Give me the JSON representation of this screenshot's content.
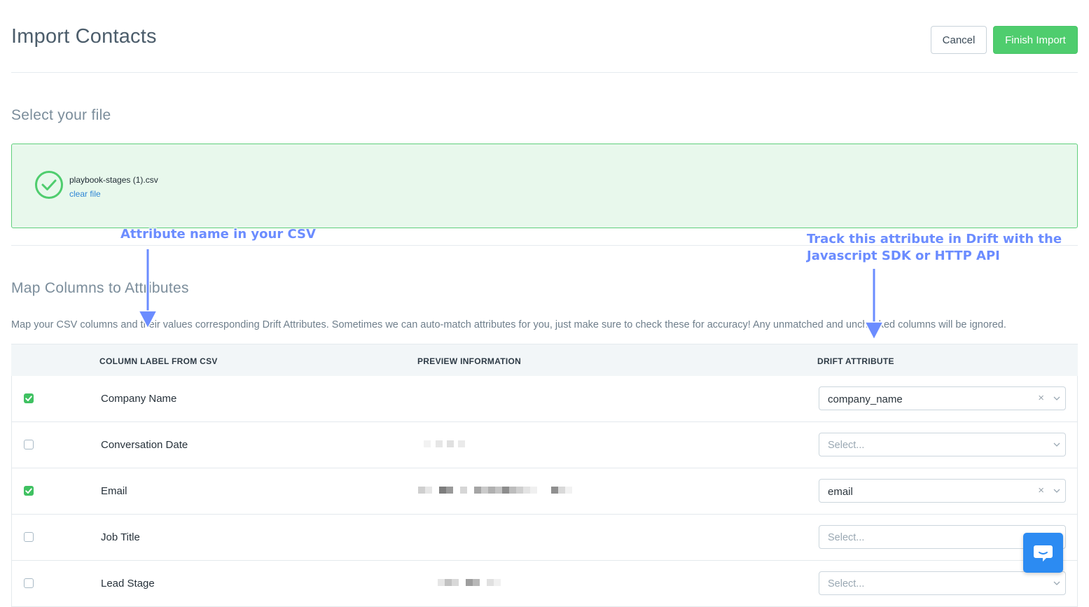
{
  "header": {
    "title": "Import Contacts",
    "cancel_label": "Cancel",
    "finish_label": "Finish Import"
  },
  "file_section": {
    "title": "Select your file",
    "file_name": "playbook-stages (1).csv",
    "clear_label": "clear file",
    "accent": "#4fcd6e"
  },
  "map_section": {
    "title": "Map Columns to Attributes",
    "description": "Map your CSV columns and their values corresponding Drift Attributes. Sometimes we can auto-match attributes for you, just make sure to check these for accuracy! Any unmatched and unchecked columns will be ignored."
  },
  "table": {
    "headers": [
      "COLUMN LABEL FROM CSV",
      "PREVIEW INFORMATION",
      "DRIFT ATTRIBUTE"
    ],
    "rows": [
      {
        "checked": true,
        "label": "Company Name",
        "attribute": "company_name",
        "placeholder": ""
      },
      {
        "checked": false,
        "label": "Conversation Date",
        "attribute": "",
        "placeholder": "Select..."
      },
      {
        "checked": true,
        "label": "Email",
        "attribute": "email",
        "placeholder": ""
      },
      {
        "checked": false,
        "label": "Job Title",
        "attribute": "",
        "placeholder": "Select..."
      },
      {
        "checked": false,
        "label": "Lead Stage",
        "attribute": "",
        "placeholder": "Select..."
      }
    ]
  },
  "annotations": {
    "left": "Attribute name in your CSV",
    "right_line1": "Track this attribute in Drift with the",
    "right_line2": "Javascript SDK or HTTP API",
    "color": "#6b8cff"
  },
  "icons": {
    "file_status": "check-circle-icon",
    "chat": "chat-bubble-icon",
    "clear": "x-icon",
    "dropdown": "chevron-down-icon"
  }
}
